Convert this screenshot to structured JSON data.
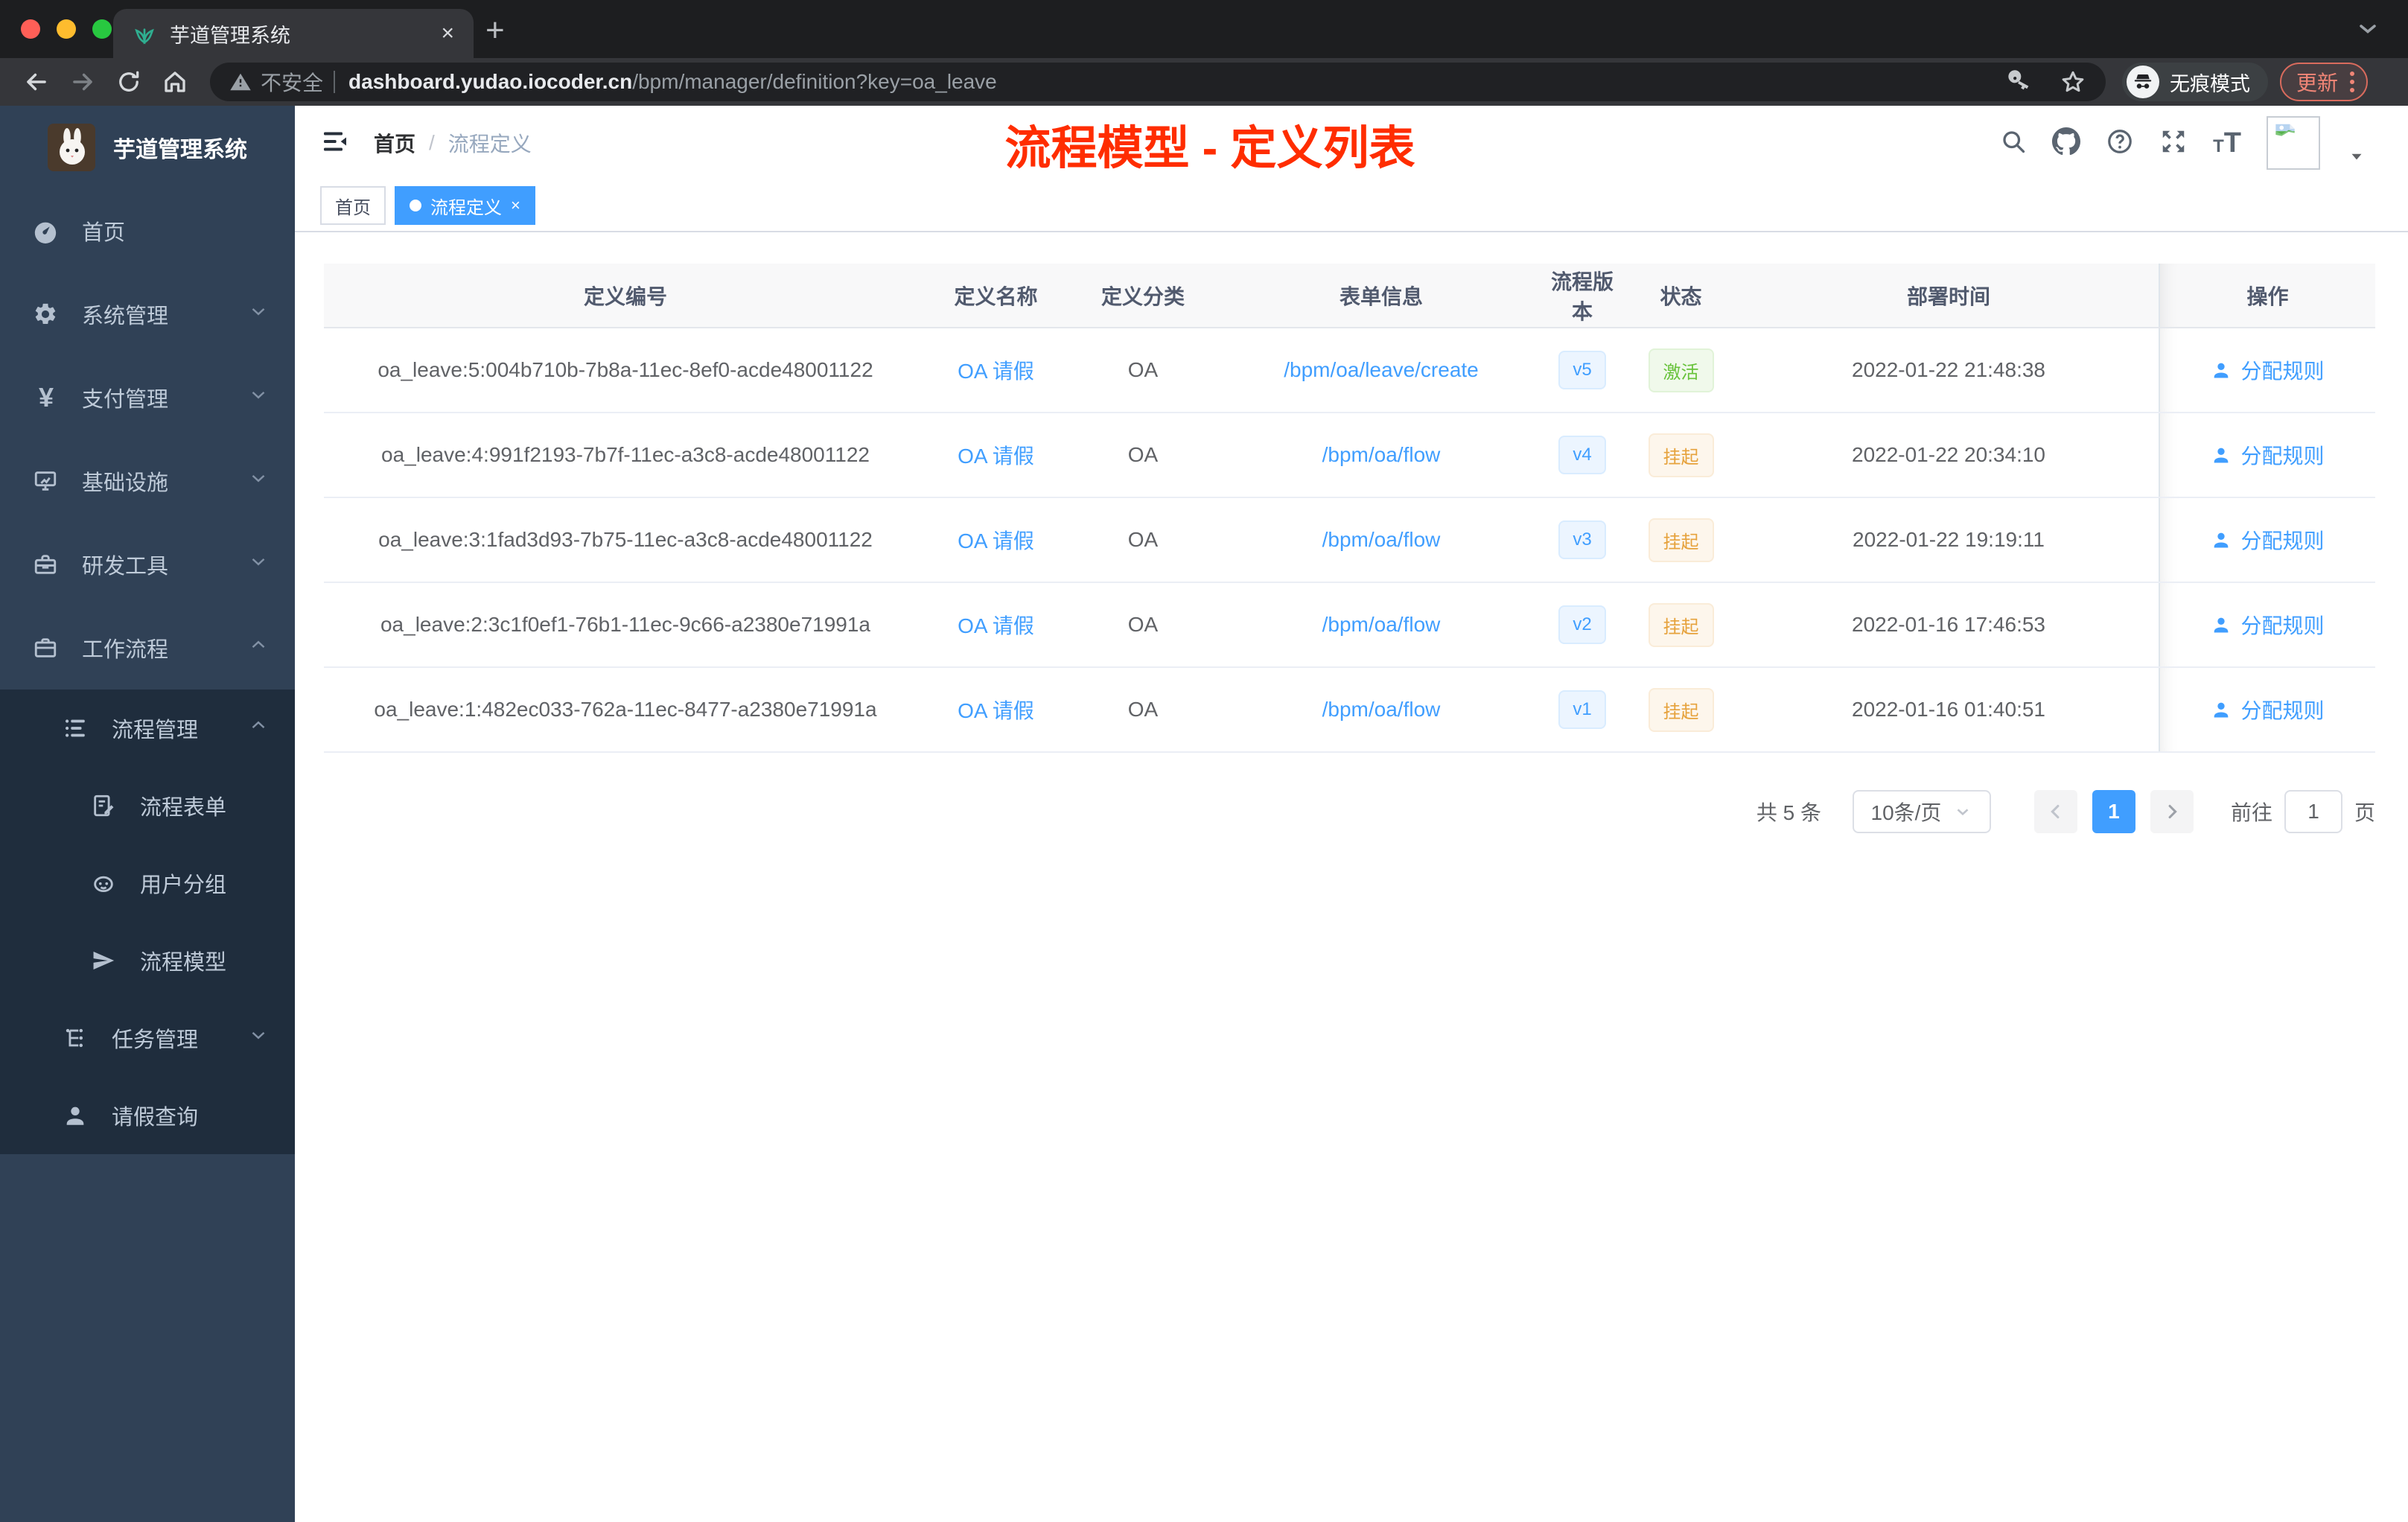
{
  "colors": {
    "accent": "#409eff",
    "success": "#67c23a",
    "warning": "#e6a23c",
    "sidebar_bg": "#304156",
    "submenu_bg": "#1f2d3d",
    "annotation_red": "#ff2d00"
  },
  "browser": {
    "tab_title": "芋道管理系统",
    "tab_close": "×",
    "new_tab": "+",
    "security_label": "不安全",
    "url_host": "dashboard.yudao.iocoder.cn",
    "url_path": "/bpm/manager/definition?key=oa_leave",
    "incognito_label": "无痕模式",
    "update_label": "更新"
  },
  "annotation": {
    "text": "流程模型 - 定义列表",
    "color": "#ff2d00"
  },
  "sidebar": {
    "logo_title": "芋道管理系统",
    "items": [
      {
        "label": "首页",
        "icon": "dashboard-icon"
      },
      {
        "label": "系统管理",
        "icon": "gear-icon"
      },
      {
        "label": "支付管理",
        "icon": "yen-icon"
      },
      {
        "label": "基础设施",
        "icon": "monitor-icon"
      },
      {
        "label": "研发工具",
        "icon": "toolbox-icon"
      },
      {
        "label": "工作流程",
        "icon": "briefcase-icon"
      },
      {
        "label": "流程管理",
        "icon": "list-icon"
      },
      {
        "label": "流程表单",
        "icon": "form-icon"
      },
      {
        "label": "用户分组",
        "icon": "robot-icon"
      },
      {
        "label": "流程模型",
        "icon": "send-icon"
      },
      {
        "label": "任务管理",
        "icon": "tree-icon"
      },
      {
        "label": "请假查询",
        "icon": "user-icon"
      }
    ]
  },
  "navbar": {
    "breadcrumb_root": "首页",
    "breadcrumb_separator": "/",
    "breadcrumb_current": "流程定义"
  },
  "tags": {
    "home": "首页",
    "active": "流程定义",
    "close": "×"
  },
  "table": {
    "columns": [
      "定义编号",
      "定义名称",
      "定义分类",
      "表单信息",
      "流程版本",
      "状态",
      "部署时间",
      "操作"
    ],
    "rows": [
      {
        "id": "oa_leave:5:004b710b-7b8a-11ec-8ef0-acde48001122",
        "name": "OA 请假",
        "category": "OA",
        "form": "/bpm/oa/leave/create",
        "version": "v5",
        "status": "激活",
        "status_type": "success",
        "deploy_time": "2022-01-22 21:48:38",
        "action": "分配规则"
      },
      {
        "id": "oa_leave:4:991f2193-7b7f-11ec-a3c8-acde48001122",
        "name": "OA 请假",
        "category": "OA",
        "form": "/bpm/oa/flow",
        "version": "v4",
        "status": "挂起",
        "status_type": "warning",
        "deploy_time": "2022-01-22 20:34:10",
        "action": "分配规则"
      },
      {
        "id": "oa_leave:3:1fad3d93-7b75-11ec-a3c8-acde48001122",
        "name": "OA 请假",
        "category": "OA",
        "form": "/bpm/oa/flow",
        "version": "v3",
        "status": "挂起",
        "status_type": "warning",
        "deploy_time": "2022-01-22 19:19:11",
        "action": "分配规则"
      },
      {
        "id": "oa_leave:2:3c1f0ef1-76b1-11ec-9c66-a2380e71991a",
        "name": "OA 请假",
        "category": "OA",
        "form": "/bpm/oa/flow",
        "version": "v2",
        "status": "挂起",
        "status_type": "warning",
        "deploy_time": "2022-01-16 17:46:53",
        "action": "分配规则"
      },
      {
        "id": "oa_leave:1:482ec033-762a-11ec-8477-a2380e71991a",
        "name": "OA 请假",
        "category": "OA",
        "form": "/bpm/oa/flow",
        "version": "v1",
        "status": "挂起",
        "status_type": "warning",
        "deploy_time": "2022-01-16 01:40:51",
        "action": "分配规则"
      }
    ]
  },
  "pagination": {
    "total_text": "共 5 条",
    "page_size": "10条/页",
    "current_page": "1",
    "goto_label": "前往",
    "page_unit": "页"
  }
}
